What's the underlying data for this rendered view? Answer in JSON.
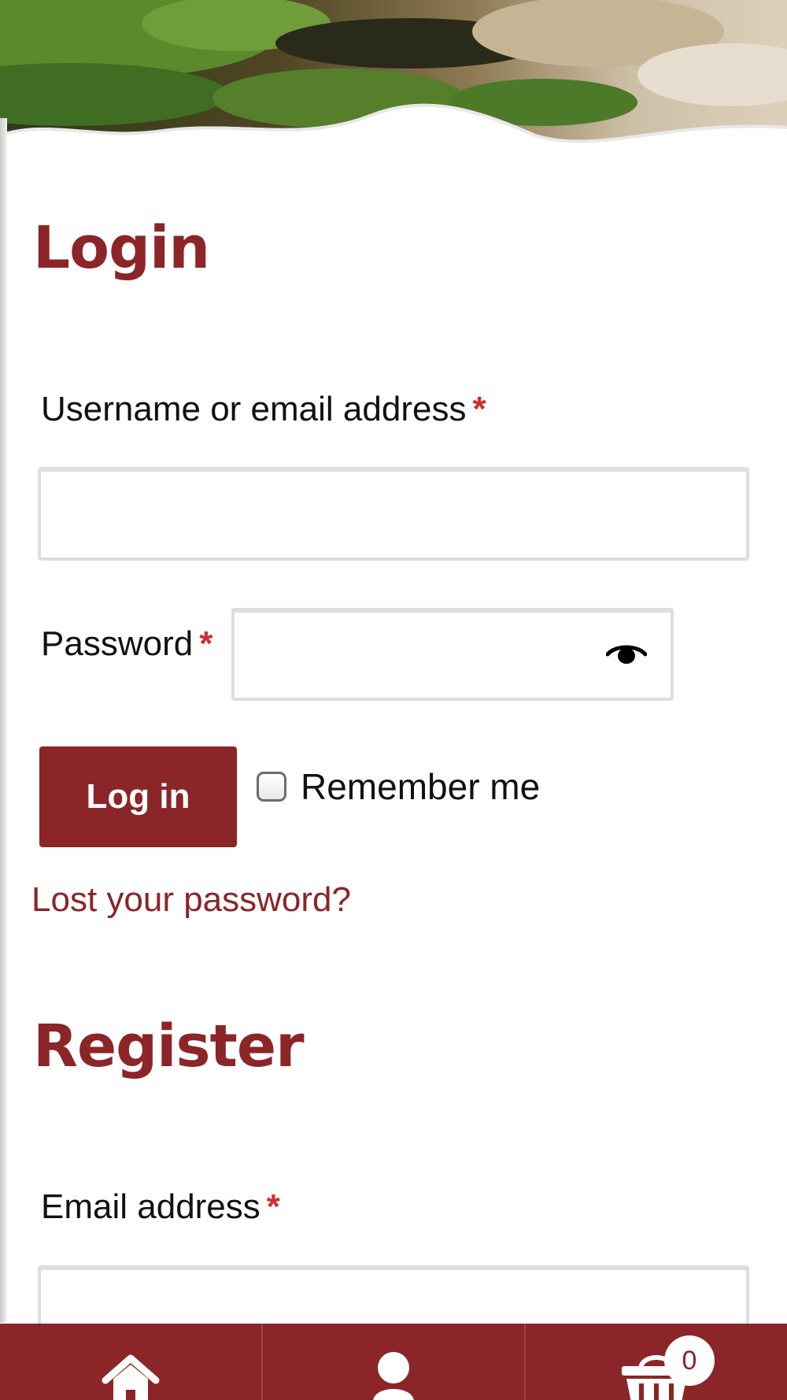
{
  "colors": {
    "accent": "#8b2527",
    "required": "#d52b2b",
    "field_border": "#dedede"
  },
  "login": {
    "heading": "Login",
    "username_label": "Username or email address",
    "password_label": "Password",
    "required_marker": "*",
    "username_value": "",
    "password_value": "",
    "button_label": "Log in",
    "remember_label": "Remember me",
    "remember_checked": false,
    "lost_password_link": "Lost your password?"
  },
  "register": {
    "heading": "Register",
    "email_label": "Email address",
    "required_marker": "*",
    "email_value": ""
  },
  "bottom_nav": {
    "items": [
      {
        "icon": "home-icon"
      },
      {
        "icon": "user-icon"
      },
      {
        "icon": "basket-icon",
        "badge": "0"
      }
    ]
  }
}
